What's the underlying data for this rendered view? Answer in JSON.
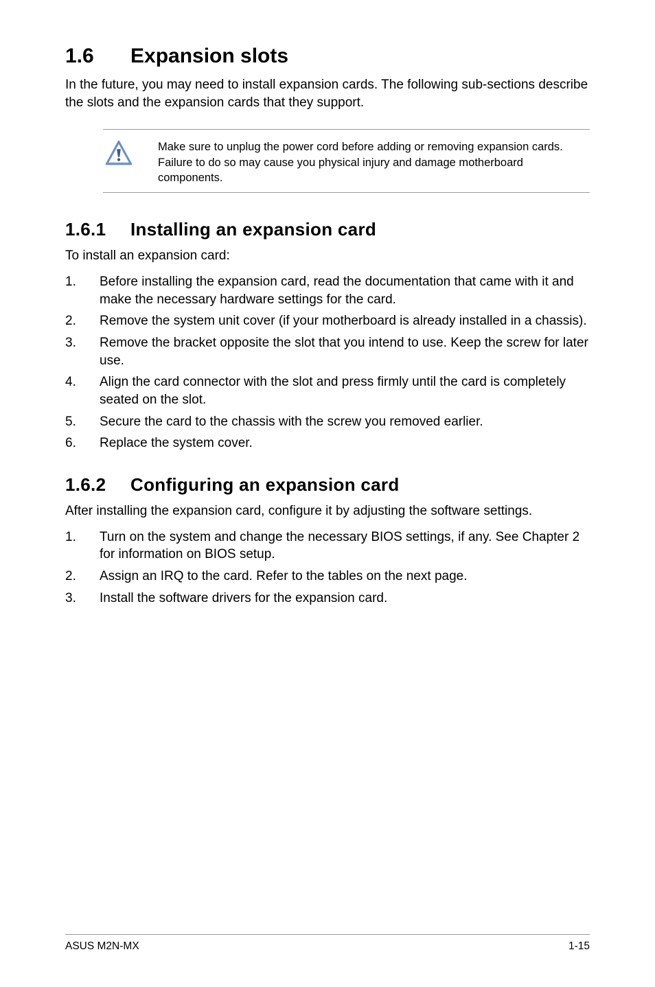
{
  "section": {
    "number": "1.6",
    "title": "Expansion slots",
    "intro": "In the future, you may need to install expansion cards. The following sub-sections describe the slots and the expansion cards that they support."
  },
  "callout": {
    "text": "Make sure to unplug the power cord before adding or removing expansion cards. Failure to do so may cause you physical injury and damage motherboard components."
  },
  "subsection1": {
    "number": "1.6.1",
    "title": "Installing an expansion card",
    "intro": "To install an expansion card:",
    "items": [
      "Before installing the expansion card, read the documentation that came with it and make the necessary hardware settings for the card.",
      "Remove the system unit cover (if your motherboard is already installed in a chassis).",
      "Remove the bracket opposite the slot that you intend to use. Keep the screw for later use.",
      "Align the card connector with the slot and press firmly until the card is completely seated on the slot.",
      "Secure the card to the chassis with the screw you removed earlier.",
      "Replace the system cover."
    ]
  },
  "subsection2": {
    "number": "1.6.2",
    "title": "Configuring an expansion card",
    "intro": "After installing the expansion card, configure it by adjusting the software settings.",
    "items": [
      "Turn on the system and change the necessary BIOS settings, if any. See Chapter 2 for information on BIOS setup.",
      "Assign an IRQ to the card. Refer to the tables on the next page.",
      "Install the software drivers for the expansion card."
    ]
  },
  "footer": {
    "left": "ASUS M2N-MX",
    "right": "1-15"
  }
}
